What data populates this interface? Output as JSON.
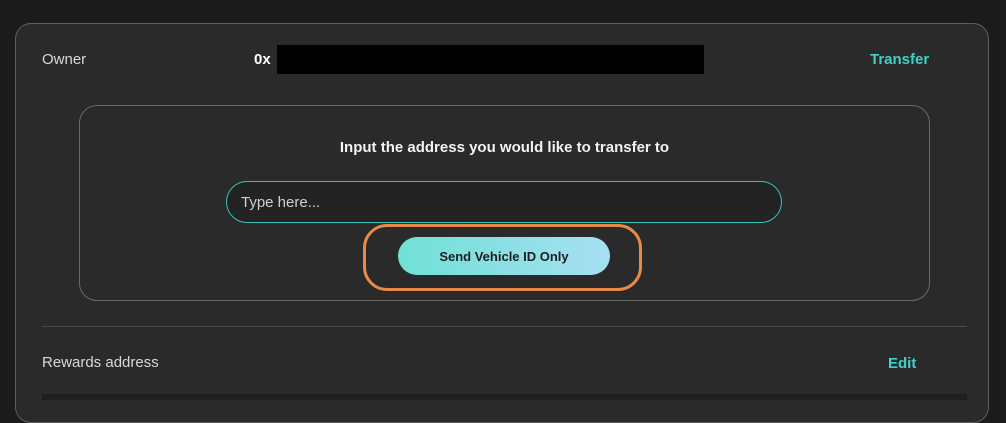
{
  "owner": {
    "label": "Owner",
    "address_prefix": "0x",
    "transfer_label": "Transfer"
  },
  "transfer": {
    "instruction": "Input the address you would like to transfer to",
    "input_placeholder": "Type here...",
    "input_value": "",
    "send_button_label": "Send Vehicle ID Only"
  },
  "rewards": {
    "label": "Rewards address",
    "edit_label": "Edit"
  },
  "colors": {
    "accent": "#3fd0c9",
    "highlight": "#e8894a",
    "background": "#2a2a2a"
  }
}
